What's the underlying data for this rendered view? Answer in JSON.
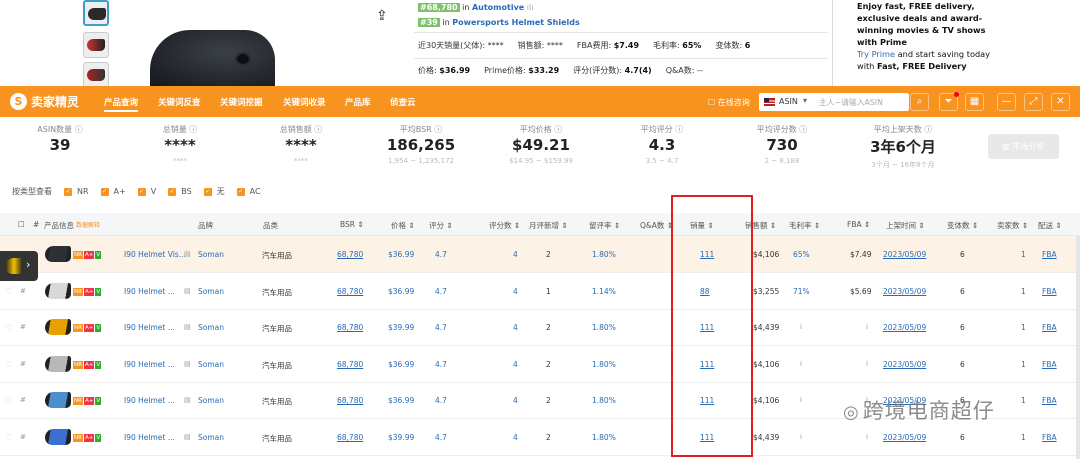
{
  "amazon": {
    "rank1_badge": "#68,780",
    "rank1_in": "in",
    "rank1_cat": "Automotive",
    "rank2_badge": "#39",
    "rank2_in": "in",
    "rank2_cat": "Powersports Helmet Shields",
    "m1": "近30天销量(父体): ****",
    "m2": "销售额: ****",
    "m3l": "FBA费用: ",
    "m3v": "$7.49",
    "m4l": "毛利率: ",
    "m4v": "65%",
    "m5l": "变体数: ",
    "m5v": "6",
    "p1l": "价格: ",
    "p1v": "$36.99",
    "p2l": "Prime价格: ",
    "p2v": "$33.29",
    "p3l": "评分(评分数): ",
    "p3v": "4.7(4)",
    "p4": "Q&A数: --",
    "prime_l1": "Enjoy fast, FREE delivery,",
    "prime_l2": "exclusive deals and award-",
    "prime_l3": "winning movies & TV shows",
    "prime_l4": "with Prime",
    "prime_l5a": "Try Prime",
    "prime_l5b": " and start saving today",
    "prime_l6a": "with ",
    "prime_l6b": "Fast, FREE Delivery"
  },
  "toolbar": {
    "logo": "卖家精灵",
    "nav": [
      "产品查询",
      "关键词反查",
      "关键词挖掘",
      "关键词收录",
      "产品库",
      "侦查云"
    ],
    "feedback": "在线咨询",
    "market": "ASIN",
    "search_placeholder": "主人~请输入ASIN",
    "search_icon": "search-icon",
    "accent": "#f7931e"
  },
  "stats": [
    {
      "label": "ASIN数量",
      "value": "39",
      "sub": ""
    },
    {
      "label": "总销量",
      "value": "****",
      "sub": "****"
    },
    {
      "label": "总销售额",
      "value": "****",
      "sub": "****"
    },
    {
      "label": "平均BSR",
      "value": "186,265",
      "sub": "1,954 ~ 1,235,172"
    },
    {
      "label": "平均价格",
      "value": "$49.21",
      "sub": "$14.95 ~ $159.99"
    },
    {
      "label": "平均评分",
      "value": "4.3",
      "sub": "3.5 ~ 4.7"
    },
    {
      "label": "平均评分数",
      "value": "730",
      "sub": "2 ~ 8,188"
    },
    {
      "label": "平均上架天数",
      "value": "3年6个月",
      "sub": "3个月 ~ 16年8个月"
    }
  ],
  "market_button": "市场分析",
  "filters": {
    "label": "按类型查看",
    "items": [
      "NR",
      "A+",
      "V",
      "BS",
      "无",
      "AC"
    ]
  },
  "table": {
    "headers": [
      "#",
      "产品信息",
      "数据解释",
      "品牌",
      "品类",
      "BSR",
      "价格",
      "评分",
      "评分数",
      "月评新增",
      "留评率",
      "Q&A数",
      "销量",
      "销售额",
      "毛利率",
      "FBA",
      "上架时间",
      "变体数",
      "卖家数",
      "配送"
    ],
    "rows": [
      {
        "title": "I90 Helmet Vis...",
        "brand": "Soman",
        "cat": "汽车用品",
        "bsr": "68,780",
        "price": "$36.99",
        "rating": "4.7",
        "ratings": "4",
        "new": "2",
        "rate": "1.80%",
        "qa": "",
        "sales": "111",
        "revenue": "$4,106",
        "margin": "65%",
        "fba": "$7.49",
        "date": "2023/05/09",
        "variants": "6",
        "sellers": "1",
        "ship": "FBA",
        "color": "#2d3036"
      },
      {
        "title": "I90 Helmet ...",
        "brand": "Soman",
        "cat": "汽车用品",
        "bsr": "68,780",
        "price": "$36.99",
        "rating": "4.7",
        "ratings": "4",
        "new": "1",
        "rate": "1.14%",
        "qa": "",
        "sales": "88",
        "revenue": "$3,255",
        "margin": "71%",
        "fba": "$5.69",
        "date": "2023/05/09",
        "variants": "6",
        "sellers": "1",
        "ship": "FBA",
        "color": "#d8d8d8"
      },
      {
        "title": "I90 Helmet ...",
        "brand": "Soman",
        "cat": "汽车用品",
        "bsr": "68,780",
        "price": "$39.99",
        "rating": "4.7",
        "ratings": "4",
        "new": "2",
        "rate": "1.80%",
        "qa": "",
        "sales": "111",
        "revenue": "$4,439",
        "margin": "i",
        "fba": "i",
        "date": "2023/05/09",
        "variants": "6",
        "sellers": "1",
        "ship": "FBA",
        "color": "#e8a000"
      },
      {
        "title": "I90 Helmet ...",
        "brand": "Soman",
        "cat": "汽车用品",
        "bsr": "68,780",
        "price": "$36.99",
        "rating": "4.7",
        "ratings": "4",
        "new": "2",
        "rate": "1.80%",
        "qa": "",
        "sales": "111",
        "revenue": "$4,106",
        "margin": "i",
        "fba": "i",
        "date": "2023/05/09",
        "variants": "6",
        "sellers": "1",
        "ship": "FBA",
        "color": "#b8b8b8"
      },
      {
        "title": "I90 Helmet ...",
        "brand": "Soman",
        "cat": "汽车用品",
        "bsr": "68,780",
        "price": "$36.99",
        "rating": "4.7",
        "ratings": "4",
        "new": "2",
        "rate": "1.80%",
        "qa": "",
        "sales": "111",
        "revenue": "$4,106",
        "margin": "i",
        "fba": "i",
        "date": "2023/05/09",
        "variants": "6",
        "sellers": "1",
        "ship": "FBA",
        "color": "#4a90d0"
      },
      {
        "title": "I90 Helmet ...",
        "brand": "Soman",
        "cat": "汽车用品",
        "bsr": "68,780",
        "price": "$39.99",
        "rating": "4.7",
        "ratings": "4",
        "new": "2",
        "rate": "1.80%",
        "qa": "",
        "sales": "111",
        "revenue": "$4,439",
        "margin": "i",
        "fba": "i",
        "date": "2023/05/09",
        "variants": "6",
        "sellers": "1",
        "ship": "FBA",
        "color": "#3b6fd0"
      }
    ]
  },
  "watermark": "跨境电商超仔"
}
